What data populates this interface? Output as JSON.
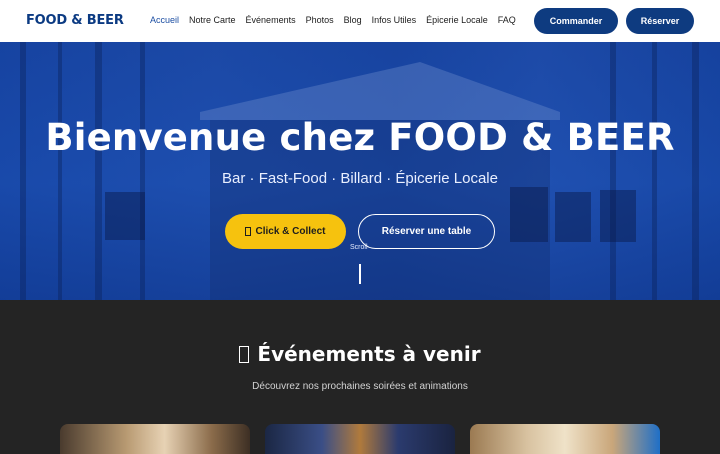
{
  "brand": {
    "logo": "FOOD & BEER"
  },
  "nav": {
    "items": [
      {
        "label": "Accueil",
        "active": true
      },
      {
        "label": "Notre Carte"
      },
      {
        "label": "Événements"
      },
      {
        "label": "Photos"
      },
      {
        "label": "Blog"
      },
      {
        "label": "Infos Utiles"
      },
      {
        "label": "Épicerie Locale"
      },
      {
        "label": "FAQ"
      }
    ],
    "commander_label": "Commander",
    "reserver_label": "Réserver"
  },
  "hero": {
    "title": "Bienvenue chez FOOD & BEER",
    "subtitle": "Bar · Fast-Food · Billard · Épicerie Locale",
    "click_collect_label": "Click & Collect",
    "reserver_table_label": "Réserver une table",
    "scroll_label": "Scroll"
  },
  "events": {
    "title": "Événements à venir",
    "subtitle": "Découvrez nos prochaines soirées et animations"
  },
  "colors": {
    "brand_blue": "#0e3b80",
    "accent_yellow": "#f6c20e",
    "hero_blue": "#1d4fb8",
    "dark_section": "#242424"
  }
}
